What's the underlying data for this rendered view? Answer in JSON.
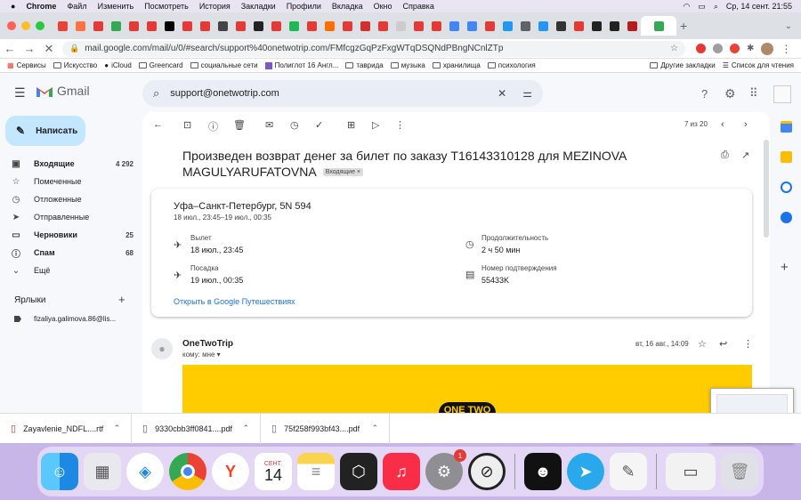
{
  "menubar": {
    "items": [
      "Chrome",
      "Файл",
      "Изменить",
      "Посмотреть",
      "История",
      "Закладки",
      "Профили",
      "Вкладка",
      "Окно",
      "Справка"
    ],
    "clock": "Ср, 14 сент.  21:55"
  },
  "tabs": {
    "favicon_colors": [
      "#ea4335",
      "#ff7043",
      "#e53935",
      "#34a853",
      "#e53935",
      "#e53935",
      "#000000",
      "#e53935",
      "#e53935",
      "#444444",
      "#e53935",
      "#222222",
      "#e53935",
      "#1db954",
      "#e53935",
      "#ff6d00",
      "#e53935",
      "#d32f2f",
      "#e53935",
      "#cccccc",
      "#e53935",
      "#e53935",
      "#4285f4",
      "#4285f4",
      "#e53935",
      "#2196f3",
      "#5f6368",
      "#2196f3",
      "#333333",
      "#e53935",
      "#222222",
      "#222222",
      "#b71c1c",
      "#34a853"
    ]
  },
  "address": {
    "url": "mail.google.com/mail/u/0/#search/support%40onetwotrip.com/FMfcgzGqPzFxgWTqDSQNdPBngNCnlZTp"
  },
  "bookmarks": {
    "items": [
      "Сервисы",
      "Искусство",
      "iCloud",
      "Greencard",
      "социальные сети",
      "Полиглот 16 Англ...",
      "тавридa",
      "музыка",
      "хранилища",
      "психология"
    ],
    "others": [
      "Другие закладки",
      "Список для чтения"
    ]
  },
  "gmail": {
    "logo": "Gmail",
    "compose": "Написать",
    "nav": [
      {
        "label": "Входящие",
        "count": "4 292",
        "icon": "inbox-icon",
        "glyph": "▣",
        "bold": true
      },
      {
        "label": "Помеченные",
        "count": "",
        "icon": "star-icon",
        "glyph": "☆",
        "bold": false
      },
      {
        "label": "Отложенные",
        "count": "",
        "icon": "clock-icon",
        "glyph": "◷",
        "bold": false
      },
      {
        "label": "Отправленные",
        "count": "",
        "icon": "send-icon",
        "glyph": "➤",
        "bold": false
      },
      {
        "label": "Черновики",
        "count": "25",
        "icon": "draft-icon",
        "glyph": "▭",
        "bold": true
      },
      {
        "label": "Спам",
        "count": "68",
        "icon": "spam-icon",
        "glyph": "ⓘ",
        "bold": true
      },
      {
        "label": "Ещё",
        "count": "",
        "icon": "more-icon",
        "glyph": "⌄",
        "bold": false
      }
    ],
    "labels_header": "Ярлыки",
    "label_item": "fizaliya.galimova.86@lis...",
    "search_value": "support@onetwotrip.com",
    "pager": "7 из 20",
    "subject": "Произведен возврат денег за билет по заказу T16143310128 для MEZINOVA MAGULYARUFATOVNA",
    "inbox_chip": "Входящие ×",
    "flight": {
      "title": "Уфа–Санкт-Петербург, 5N 594",
      "subtitle": "18 июл., 23:45–19 июл., 00:35",
      "depart_label": "Вылет",
      "depart_value": "18 июл., 23:45",
      "arrive_label": "Посадка",
      "arrive_value": "19 июл., 00:35",
      "duration_label": "Продолжительность",
      "duration_value": "2 ч 50 мин",
      "confirm_label": "Номер подтверждения",
      "confirm_value": "55433K",
      "link": "Открыть в Google Путешествиях"
    },
    "message": {
      "sender": "OneTwoTrip",
      "to": "кому: мне",
      "date": "вт, 16 авг., 14:09",
      "banner_text": "ONE TWO",
      "banner_color": "#ffcc00"
    }
  },
  "downloads": [
    {
      "name": "Zayavlenie_NDFL....rtf"
    },
    {
      "name": "9330cbb3ff0841....pdf"
    },
    {
      "name": "75f258f993bf43....pdf"
    }
  ],
  "dock": {
    "calendar_month": "СЕНТ.",
    "calendar_day": "14",
    "badge": "1"
  }
}
